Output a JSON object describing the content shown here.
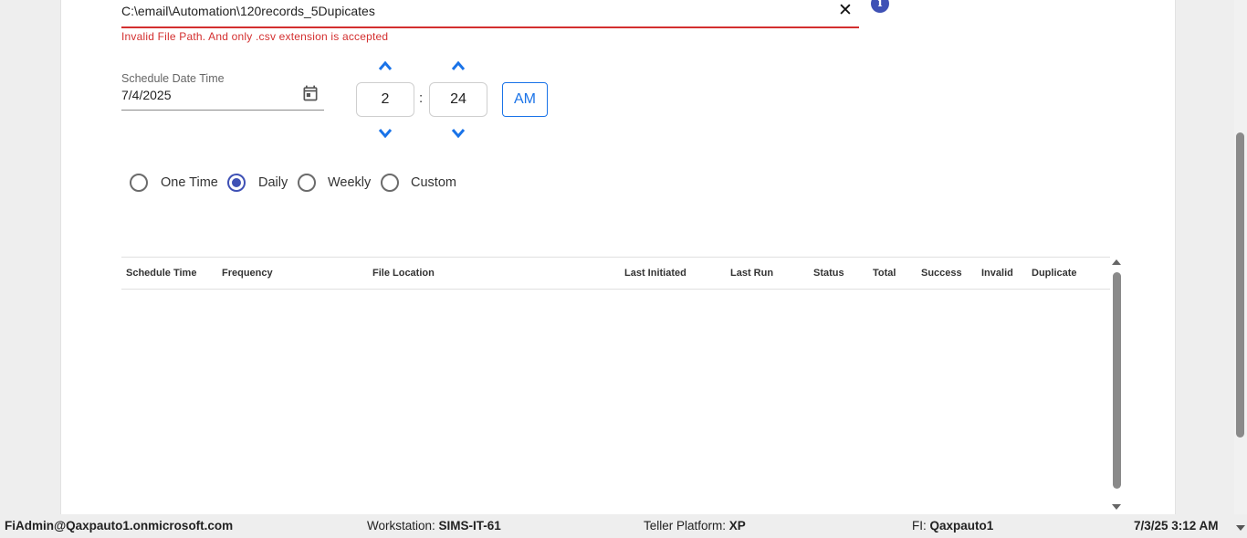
{
  "upload": {
    "file_path": "C:\\email\\Automation\\120records_5Dupicates",
    "clear_icon": "close-icon",
    "error": "Invalid File Path. And only .csv extension is accepted",
    "info_icon": "info-icon",
    "info_glyph": "i"
  },
  "schedule": {
    "label": "Schedule Date Time",
    "date": "7/4/2025",
    "hour": "2",
    "minute": "24",
    "separator": ":",
    "meridiem": "AM"
  },
  "frequency": {
    "options": [
      "One Time",
      "Daily",
      "Weekly",
      "Custom"
    ],
    "selected": "Daily"
  },
  "table": {
    "columns": [
      "Schedule Time",
      "Frequency",
      "File Location",
      "Last Initiated",
      "Last Run",
      "Status",
      "Total",
      "Success",
      "Invalid",
      "Duplicate"
    ],
    "rows": []
  },
  "footer": {
    "user": "FiAdmin@Qaxpauto1.onmicrosoft.com",
    "workstation_label": "Workstation:",
    "workstation": "SIMS-IT-61",
    "platform_label": "Teller Platform:",
    "platform": "XP",
    "fi_label": "FI:",
    "fi": "Qaxpauto1",
    "datetime": "7/3/25 3:12 AM"
  },
  "colors": {
    "accent": "#3f51b5",
    "error": "#d32f2f",
    "link_blue": "#1a73e8"
  }
}
